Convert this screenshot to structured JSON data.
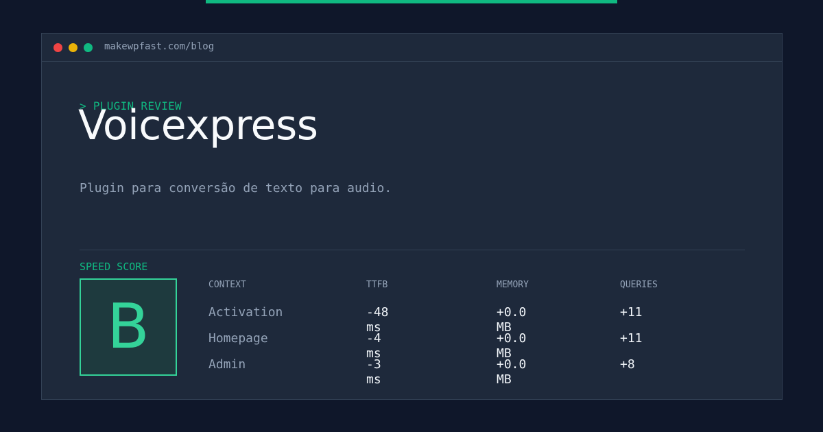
{
  "window": {
    "url": "makewpfast.com/blog",
    "colors": {
      "close": "#ef4444",
      "minimize": "#eab308",
      "maximize": "#10b981"
    }
  },
  "accent_color": "#10b981",
  "header": {
    "kicker": "> PLUGIN REVIEW",
    "title": "Voicexpress",
    "description": "Plugin para conversão de texto para audio."
  },
  "score": {
    "label": "SPEED SCORE",
    "grade": "B"
  },
  "metrics": {
    "columns": [
      "CONTEXT",
      "TTFB",
      "MEMORY",
      "QUERIES"
    ],
    "rows": [
      {
        "context": "Activation",
        "ttfb": "-48 ms",
        "memory": "+0.0 MB",
        "queries": "+11"
      },
      {
        "context": "Homepage",
        "ttfb": "-4 ms",
        "memory": "+0.0 MB",
        "queries": "+11"
      },
      {
        "context": "Admin",
        "ttfb": "-3 ms",
        "memory": "+0.0 MB",
        "queries": "+8"
      }
    ]
  }
}
